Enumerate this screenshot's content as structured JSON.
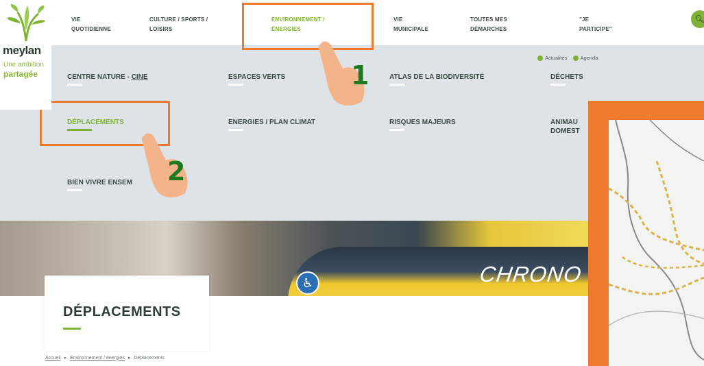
{
  "logo": {
    "name": "meylan",
    "tagline_1": "Une ambition",
    "tagline_2": "partagée"
  },
  "nav": {
    "items": [
      {
        "line1": "VIE",
        "line2": "QUOTIDIENNE"
      },
      {
        "line1": "CULTURE / SPORTS /",
        "line2": "LOISIRS"
      },
      {
        "line1": "ENVIRONNEMENT /",
        "line2": "ÉNERGIES"
      },
      {
        "line1": "VIE",
        "line2": "MUNICIPALE"
      },
      {
        "line1": "TOUTES MES",
        "line2": "DÉMARCHES"
      },
      {
        "line1": "\"JE",
        "line2": "PARTICIPE\""
      }
    ],
    "search_icon": "search-icon"
  },
  "quick_links": {
    "news": "Actualités",
    "agenda": "Agenda"
  },
  "menu": {
    "items": [
      {
        "label_main": "CENTRE NATURE - ",
        "label_link": "CINE"
      },
      {
        "label": "ESPACES VERTS"
      },
      {
        "label": "ATLAS DE LA BIODIVERSITÉ"
      },
      {
        "label": "DÉCHETS"
      },
      {
        "label": "DÉPLACEMENTS"
      },
      {
        "label": "ENERGIES / PLAN CLIMAT"
      },
      {
        "label": "RISQUES MAJEURS"
      },
      {
        "line1": "ANIMAU",
        "line2": "DOMEST"
      },
      {
        "label": "BIEN VIVRE ENSEM"
      }
    ]
  },
  "hero": {
    "bus_text": "CHRONO"
  },
  "page": {
    "title": "DÉPLACEMENTS"
  },
  "breadcrumb": {
    "home": "Accueil",
    "section": "Environnement / énergies",
    "current": "Déplacements",
    "sep": "▸"
  },
  "annotations": {
    "step1": "1",
    "step2": "2",
    "highlight_color": "#ee7b2d"
  },
  "colors": {
    "accent": "#7fb335",
    "menu_bg": "#dde3e6",
    "annotation": "#ee7b2d",
    "step_number": "#1e7a1e"
  }
}
